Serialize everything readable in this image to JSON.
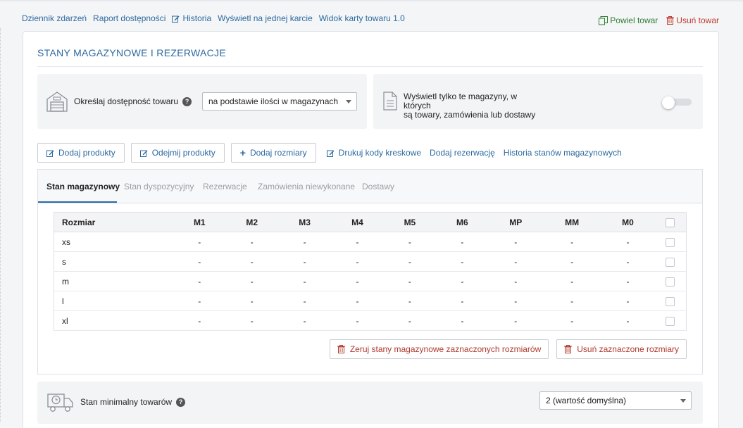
{
  "top_links": [
    {
      "label": "Dziennik zdarzeń",
      "icon": ""
    },
    {
      "label": "Raport dostępności",
      "icon": ""
    },
    {
      "label": "Historia",
      "icon": "edit-icon"
    },
    {
      "label": "Wyświetl na jednej karcie",
      "icon": ""
    },
    {
      "label": "Widok karty towaru 1.0",
      "icon": ""
    }
  ],
  "top_right": {
    "duplicate_label": "Powiel towar",
    "delete_label": "Usuń towar",
    "duplicate_color": "#2f7d32",
    "delete_color": "#c0392b"
  },
  "card": {
    "title": "STANY MAGAZYNOWE I REZERWACJE"
  },
  "availability": {
    "label": "Określaj dostępność towaru",
    "select_value": "na podstawie ilości w magazynach"
  },
  "filter": {
    "text_line1": "Wyświetl tylko te magazyny, w których",
    "text_line2": "są towary, zamówienia lub dostawy",
    "toggle_on": false
  },
  "actions": {
    "buttons": [
      {
        "label": "Dodaj produkty",
        "icon": "edit-icon"
      },
      {
        "label": "Odejmij produkty",
        "icon": "edit-icon"
      },
      {
        "label": "Dodaj rozmiary",
        "icon": "plus-icon"
      }
    ],
    "links": [
      {
        "label": "Drukuj kody kreskowe",
        "icon": "edit-icon"
      },
      {
        "label": "Dodaj rezerwację",
        "icon": ""
      },
      {
        "label": "Historia stanów magazynowych",
        "icon": ""
      }
    ]
  },
  "tabs": [
    {
      "label": "Stan magazynowy",
      "active": true
    },
    {
      "label": "Stan dyspozycyjny",
      "active": false
    },
    {
      "label": "Rezerwacje",
      "active": false
    },
    {
      "label": "Zamówienia niewykonane",
      "active": false
    },
    {
      "label": "Dostawy",
      "active": false
    }
  ],
  "table": {
    "headers": [
      "Rozmiar",
      "M1",
      "M2",
      "M3",
      "M4",
      "M5",
      "M6",
      "MP",
      "MM",
      "M0"
    ],
    "rows": [
      {
        "size": "xs",
        "values": [
          "-",
          "-",
          "-",
          "-",
          "-",
          "-",
          "-",
          "-",
          "-"
        ]
      },
      {
        "size": "s",
        "values": [
          "-",
          "-",
          "-",
          "-",
          "-",
          "-",
          "-",
          "-",
          "-"
        ]
      },
      {
        "size": "m",
        "values": [
          "-",
          "-",
          "-",
          "-",
          "-",
          "-",
          "-",
          "-",
          "-"
        ]
      },
      {
        "size": "l",
        "values": [
          "-",
          "-",
          "-",
          "-",
          "-",
          "-",
          "-",
          "-",
          "-"
        ]
      },
      {
        "size": "xl",
        "values": [
          "-",
          "-",
          "-",
          "-",
          "-",
          "-",
          "-",
          "-",
          "-"
        ]
      }
    ]
  },
  "table_actions": {
    "reset_label": "Zeruj stany magazynowe zaznaczonych rozmiarów",
    "delete_label": "Usuń zaznaczone rozmiary"
  },
  "minimum": {
    "label": "Stan minimalny towarów",
    "select_value": "2 (wartość domyślna)"
  },
  "colors": {
    "link": "#2c6aa0",
    "danger": "#b03a2e",
    "active_tab": "#2c6aa0"
  }
}
